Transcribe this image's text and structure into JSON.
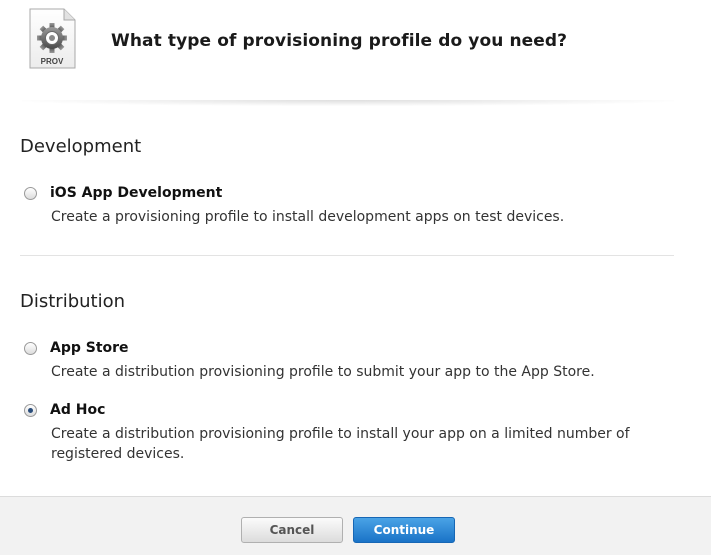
{
  "header": {
    "icon_label": "PROV",
    "title": "What type of provisioning profile do you need?"
  },
  "sections": [
    {
      "title": "Development",
      "options": [
        {
          "label": "iOS App Development",
          "description": "Create a provisioning profile to install development apps on test devices.",
          "selected": false
        }
      ]
    },
    {
      "title": "Distribution",
      "options": [
        {
          "label": "App Store",
          "description": "Create a distribution provisioning profile to submit your app to the App Store.",
          "selected": false
        },
        {
          "label": "Ad Hoc",
          "description": "Create a distribution provisioning profile to install your app on a limited number of registered devices.",
          "selected": true
        }
      ]
    }
  ],
  "footer": {
    "cancel_label": "Cancel",
    "continue_label": "Continue"
  },
  "colors": {
    "primary_button": "#2a86d6",
    "radio_selected": "#2a4d7a"
  }
}
